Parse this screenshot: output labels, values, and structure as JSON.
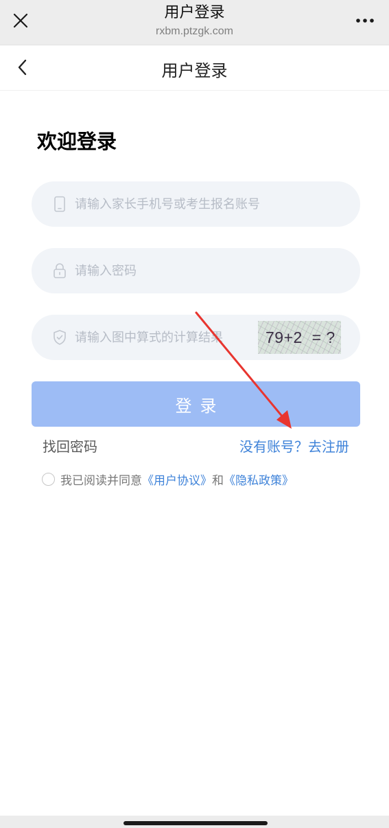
{
  "browser": {
    "title": "用户登录",
    "url": "rxbm.ptzgk.com",
    "close_icon": "close-icon",
    "more_icon": "more-icon"
  },
  "header": {
    "title": "用户登录",
    "back_icon": "chevron-left-icon"
  },
  "welcome": "欢迎登录",
  "form": {
    "account_placeholder": "请输入家长手机号或考生报名账号",
    "password_placeholder": "请输入密码",
    "captcha_placeholder": "请输入图中算式的计算结果",
    "captcha_text": "79+2  = ?",
    "login_label": "登录"
  },
  "links": {
    "forgot": "找回密码",
    "register": "没有账号？去注册"
  },
  "agreement": {
    "prefix": "我已阅读并同意",
    "user_agreement": "《用户协议》",
    "conjunction": "和",
    "privacy_policy": "《隐私政策》"
  },
  "colors": {
    "link": "#3f83d9",
    "button": "#9dbcf5",
    "input_bg": "#f1f4f8",
    "annotation_arrow": "#e8352f"
  }
}
